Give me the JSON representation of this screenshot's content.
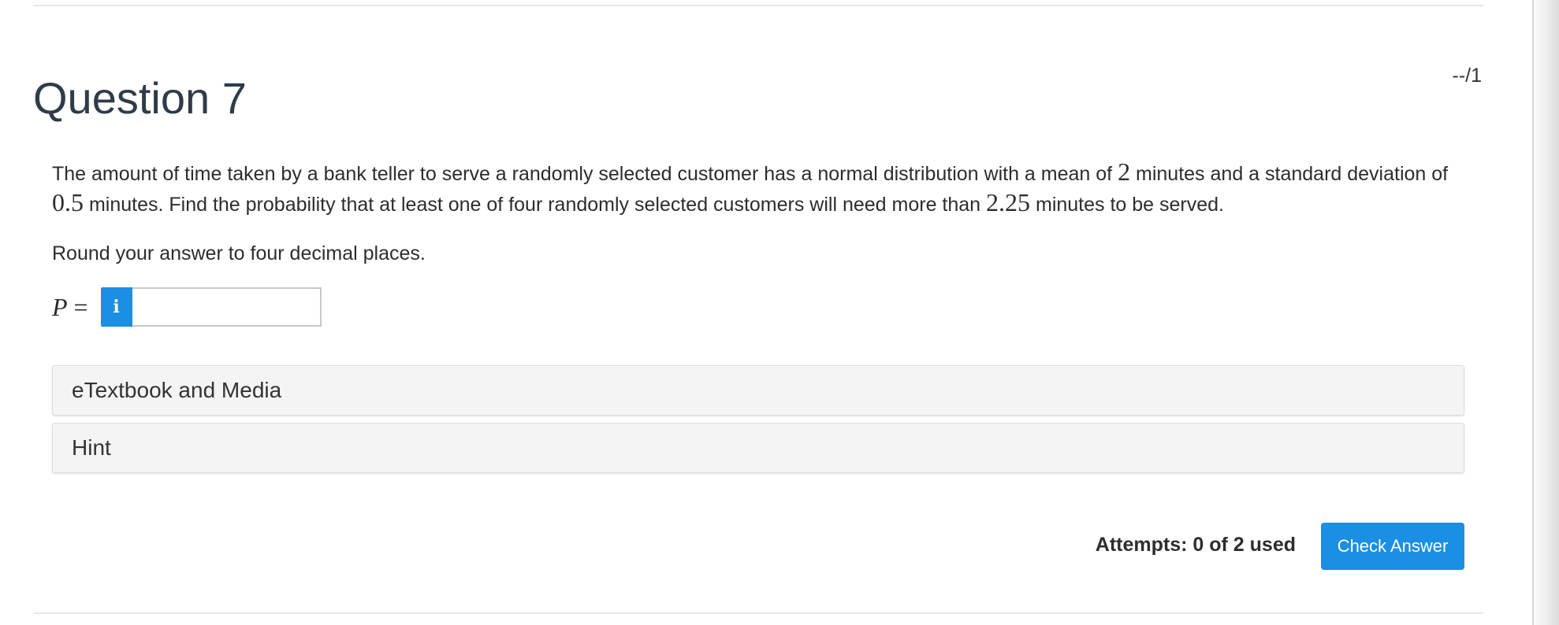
{
  "question": {
    "title": "Question 7",
    "score": "--/1",
    "body": {
      "text_1": "The amount of time taken by a bank teller to serve a randomly selected customer has a normal distribution with a mean of ",
      "mean": "2",
      "text_2": " minutes and a standard deviation of ",
      "sd": "0.5",
      "text_3": " minutes. Find the probability that at least one of four randomly selected customers will need more than ",
      "threshold": "2.25",
      "text_4": " minutes to be served."
    },
    "instruction": "Round your answer to four decimal places."
  },
  "answer": {
    "variable": "P",
    "equals": "=",
    "info_icon": "i",
    "value": ""
  },
  "panels": {
    "etextbook": "eTextbook and Media",
    "hint": "Hint"
  },
  "footer": {
    "attempts": "Attempts: 0 of 2 used",
    "check_button": "Check Answer"
  },
  "colors": {
    "accent": "#1a8fe3",
    "title": "#2f3b48",
    "panel_bg": "#f4f4f4"
  },
  "icons": {
    "info": "info-icon"
  }
}
